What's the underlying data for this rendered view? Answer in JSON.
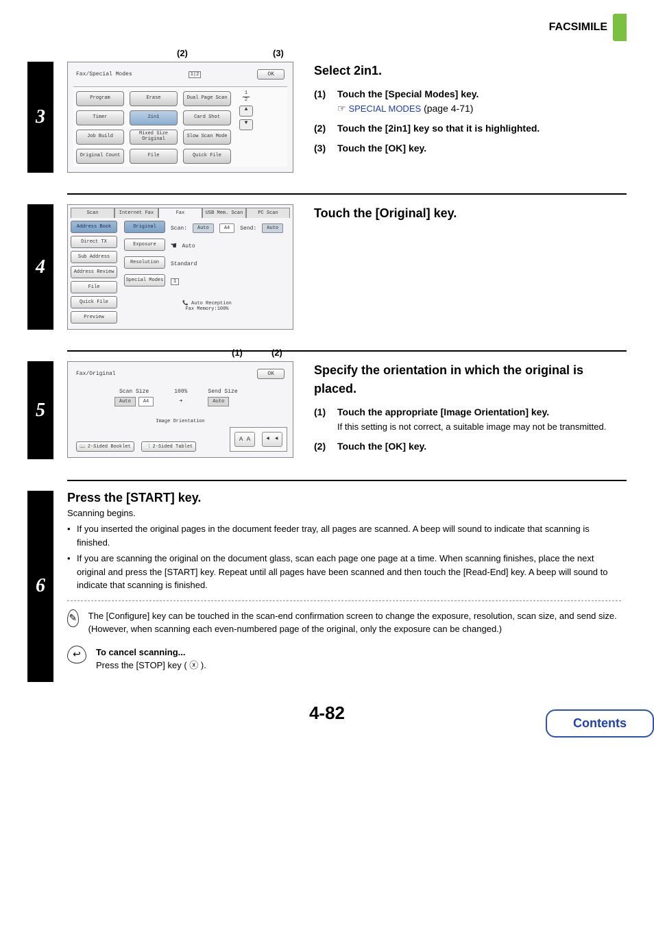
{
  "header": {
    "title": "FACSIMILE"
  },
  "footer": {
    "page": "4-82",
    "contents": "Contents"
  },
  "step3": {
    "num": "3",
    "callout2": "(2)",
    "callout3": "(3)",
    "panel": {
      "title": "Fax/Special Modes",
      "ok": "OK",
      "buttons": {
        "program": "Program",
        "erase": "Erase",
        "dualpage": "Dual Page Scan",
        "timer": "Timer",
        "twoin1": "2in1",
        "cardshot": "Card Shot",
        "jobbuild": "Job Build",
        "mixed": "Mixed Size Original",
        "slowscan": "Slow Scan Mode",
        "origcount": "Original Count",
        "file": "File",
        "quickfile": "Quick File"
      },
      "frac_top": "1",
      "frac_bot": "2"
    },
    "instr": {
      "heading": "Select 2in1.",
      "i1n": "(1)",
      "i1t": "Touch the [Special Modes] key.",
      "i1link_a": "SPECIAL MODES",
      "i1link_b": "(page 4-71)",
      "i2n": "(2)",
      "i2t": "Touch the [2in1] key so that it is highlighted.",
      "i3n": "(3)",
      "i3t": "Touch the [OK] key."
    }
  },
  "step4": {
    "num": "4",
    "tabs": {
      "scan": "Scan",
      "ifax": "Internet Fax",
      "fax": "Fax",
      "usb": "USB Mem. Scan",
      "pc": "PC Scan"
    },
    "side": {
      "addr": "Address Book",
      "direct": "Direct TX",
      "sub": "Sub Address",
      "review": "Address Review",
      "file": "File",
      "qfile": "Quick File",
      "preview": "Preview"
    },
    "rows": {
      "original": "Original",
      "scan_lbl": "Scan:",
      "auto": "Auto",
      "a4": "A4",
      "send_lbl": "Send:",
      "sendauto": "Auto",
      "exposure": "Exposure",
      "expauto": "Auto",
      "resolution": "Resolution",
      "standard": "Standard",
      "spmodes": "Special Modes"
    },
    "status": {
      "reception": "Auto Reception",
      "memory": "Fax Memory:100%"
    },
    "instr": {
      "heading": "Touch the [Original] key."
    }
  },
  "step5": {
    "num": "5",
    "callout1": "(1)",
    "callout2": "(2)",
    "panel": {
      "title": "Fax/Original",
      "ok": "OK",
      "scan_size": "Scan Size",
      "pct": "100%",
      "send_size": "Send Size",
      "scan_auto": "Auto",
      "scan_a4": "A4",
      "arrow": "➜",
      "send_auto": "Auto",
      "img_orient": "Image Orientation",
      "io1": "A A",
      "io2": "⯇ ⯇",
      "ts_booklet": "2-Sided Booklet",
      "ts_tablet": "2-Sided Tablet"
    },
    "instr": {
      "heading": "Specify the orientation in which the original is placed.",
      "i1n": "(1)",
      "i1t": "Touch the appropriate [Image Orientation] key.",
      "i1sub": "If this setting is not correct, a suitable image may not be transmitted.",
      "i2n": "(2)",
      "i2t": "Touch the [OK] key."
    }
  },
  "step6": {
    "num": "6",
    "heading": "Press the [START] key.",
    "sub": "Scanning begins.",
    "b1": "If you inserted the original pages in the document feeder tray, all pages are scanned. A beep will sound to indicate that scanning is finished.",
    "b2": "If you are scanning the original on the document glass, scan each page one page at a time. When scanning finishes, place the next original and press the [START] key. Repeat until all pages have been scanned and then touch the [Read-End] key. A beep will sound to indicate that scanning is finished.",
    "note1": "The [Configure] key can be touched in the scan-end confirmation screen to change the exposure, resolution, scan size, and send size. (However, when scanning each even-numbered page of the original, only the exposure can be changed.)",
    "cancel_h": "To cancel scanning...",
    "cancel_t": "Press the [STOP] key (  ⓧ  )."
  }
}
